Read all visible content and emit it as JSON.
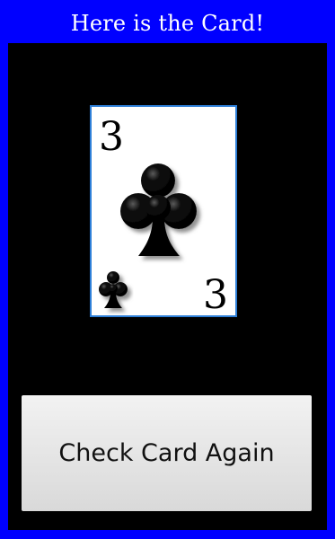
{
  "header": {
    "title": "Here is the Card!"
  },
  "card": {
    "rank": "3",
    "suit_icon": "club-icon",
    "accent_color": "#2e7fd8",
    "color": "#000000"
  },
  "actions": {
    "check_again_label": "Check Card Again"
  },
  "colors": {
    "background": "#0000ff",
    "panel": "#000000"
  }
}
